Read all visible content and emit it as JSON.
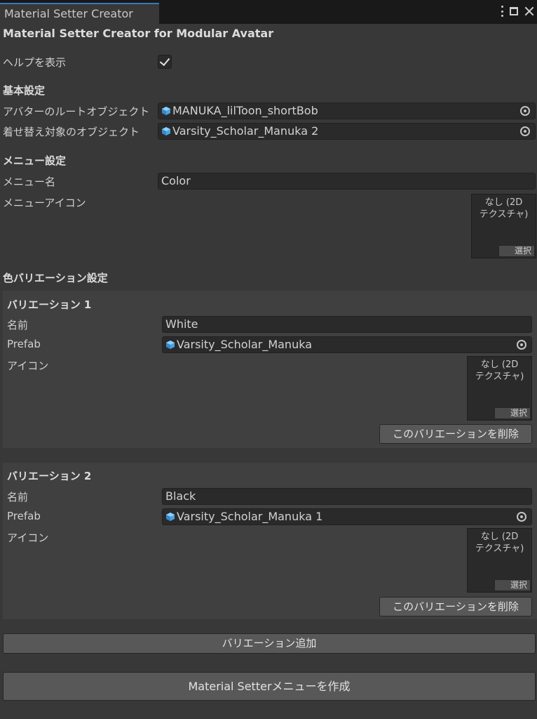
{
  "window": {
    "tab_title": "Material Setter Creator"
  },
  "header": {
    "title": "Material Setter Creator for Modular Avatar"
  },
  "help": {
    "label": "ヘルプを表示",
    "checked": true
  },
  "basic": {
    "heading": "基本設定",
    "root_label": "アバターのルートオブジェクト",
    "root_value": "MANUKA_lilToon_shortBob",
    "target_label": "着せ替え対象のオブジェクト",
    "target_value": "Varsity_Scholar_Manuka 2"
  },
  "menu": {
    "heading": "メニュー設定",
    "name_label": "メニュー名",
    "name_value": "Color",
    "icon_label": "メニューアイコン",
    "icon_placeholder_line1": "なし (2D",
    "icon_placeholder_line2": "テクスチャ)",
    "icon_select": "選択"
  },
  "variations_heading": "色バリエーション設定",
  "variations": [
    {
      "title": "バリエーション 1",
      "name_label": "名前",
      "name_value": "White",
      "prefab_label": "Prefab",
      "prefab_value": "Varsity_Scholar_Manuka",
      "icon_label": "アイコン",
      "icon_placeholder_line1": "なし (2D",
      "icon_placeholder_line2": "テクスチャ)",
      "icon_select": "選択",
      "delete_label": "このバリエーションを削除"
    },
    {
      "title": "バリエーション 2",
      "name_label": "名前",
      "name_value": "Black",
      "prefab_label": "Prefab",
      "prefab_value": "Varsity_Scholar_Manuka 1",
      "icon_label": "アイコン",
      "icon_placeholder_line1": "なし (2D",
      "icon_placeholder_line2": "テクスチャ)",
      "icon_select": "選択",
      "delete_label": "このバリエーションを削除"
    }
  ],
  "actions": {
    "add_variation": "バリエーション追加",
    "create_menu": "Material Setterメニューを作成"
  }
}
